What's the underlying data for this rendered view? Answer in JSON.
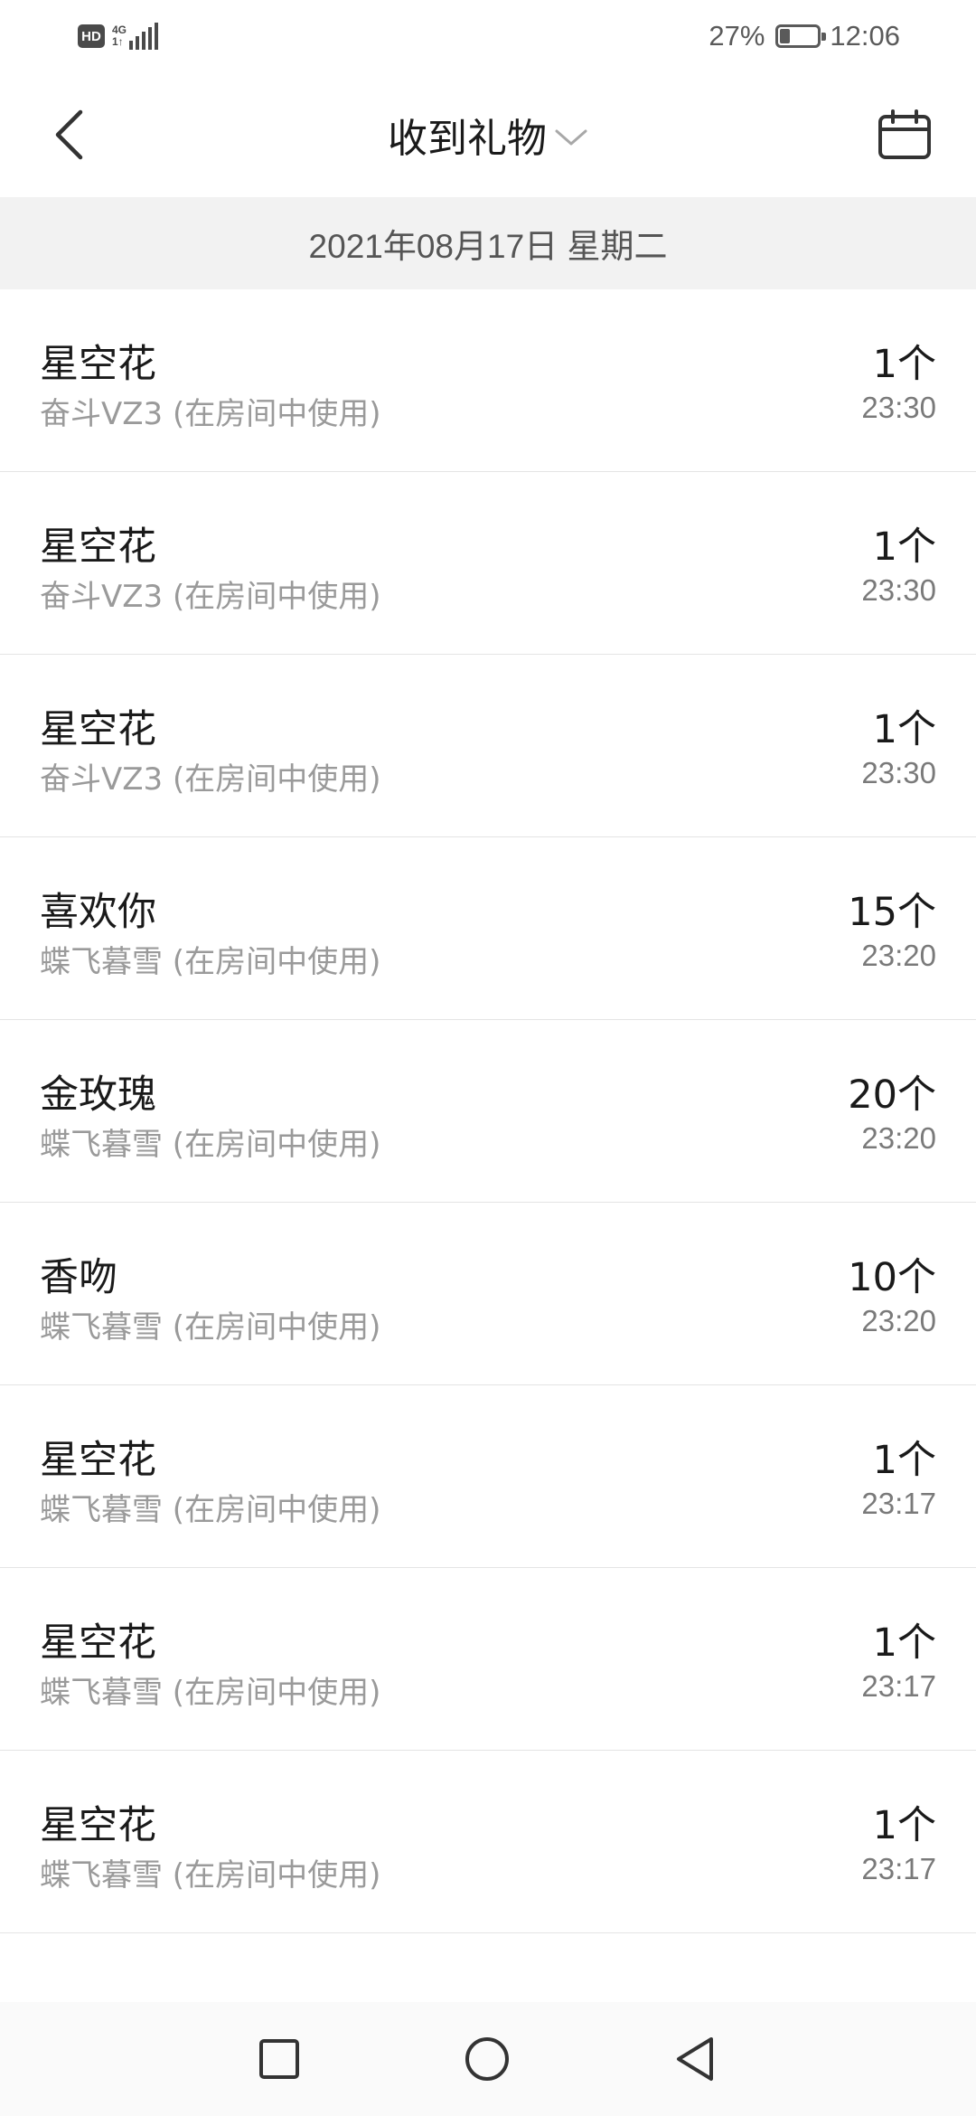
{
  "status_bar": {
    "hd": "HD",
    "network": "4G",
    "network_sub": "1↑",
    "battery": "27%",
    "battery_level": 0.27,
    "time": "12:06"
  },
  "header": {
    "title": "收到礼物",
    "back_icon": "chevron-left-icon",
    "dropdown_icon": "chevron-down-icon",
    "calendar_icon": "calendar-icon"
  },
  "date_label": "2021年08月17日 星期二",
  "gifts": [
    {
      "name": "星空花",
      "from": "奋斗VZ3 (在房间中使用)",
      "count": "1个",
      "time": "23:30"
    },
    {
      "name": "星空花",
      "from": "奋斗VZ3 (在房间中使用)",
      "count": "1个",
      "time": "23:30"
    },
    {
      "name": "星空花",
      "from": "奋斗VZ3 (在房间中使用)",
      "count": "1个",
      "time": "23:30"
    },
    {
      "name": "喜欢你",
      "from": "蝶飞暮雪 (在房间中使用)",
      "count": "15个",
      "time": "23:20"
    },
    {
      "name": "金玫瑰",
      "from": "蝶飞暮雪 (在房间中使用)",
      "count": "20个",
      "time": "23:20"
    },
    {
      "name": "香吻",
      "from": "蝶飞暮雪 (在房间中使用)",
      "count": "10个",
      "time": "23:20"
    },
    {
      "name": "星空花",
      "from": "蝶飞暮雪 (在房间中使用)",
      "count": "1个",
      "time": "23:17"
    },
    {
      "name": "星空花",
      "from": "蝶飞暮雪 (在房间中使用)",
      "count": "1个",
      "time": "23:17"
    },
    {
      "name": "星空花",
      "from": "蝶飞暮雪 (在房间中使用)",
      "count": "1个",
      "time": "23:17"
    }
  ],
  "nav": {
    "recent_icon": "square-icon",
    "home_icon": "circle-icon",
    "back_icon": "triangle-back-icon"
  },
  "colors": {
    "primary_text": "#1a1a1a",
    "secondary_text": "#9a9a9a",
    "date_bg": "#f2f2f2",
    "divider": "#e4e4e4"
  }
}
